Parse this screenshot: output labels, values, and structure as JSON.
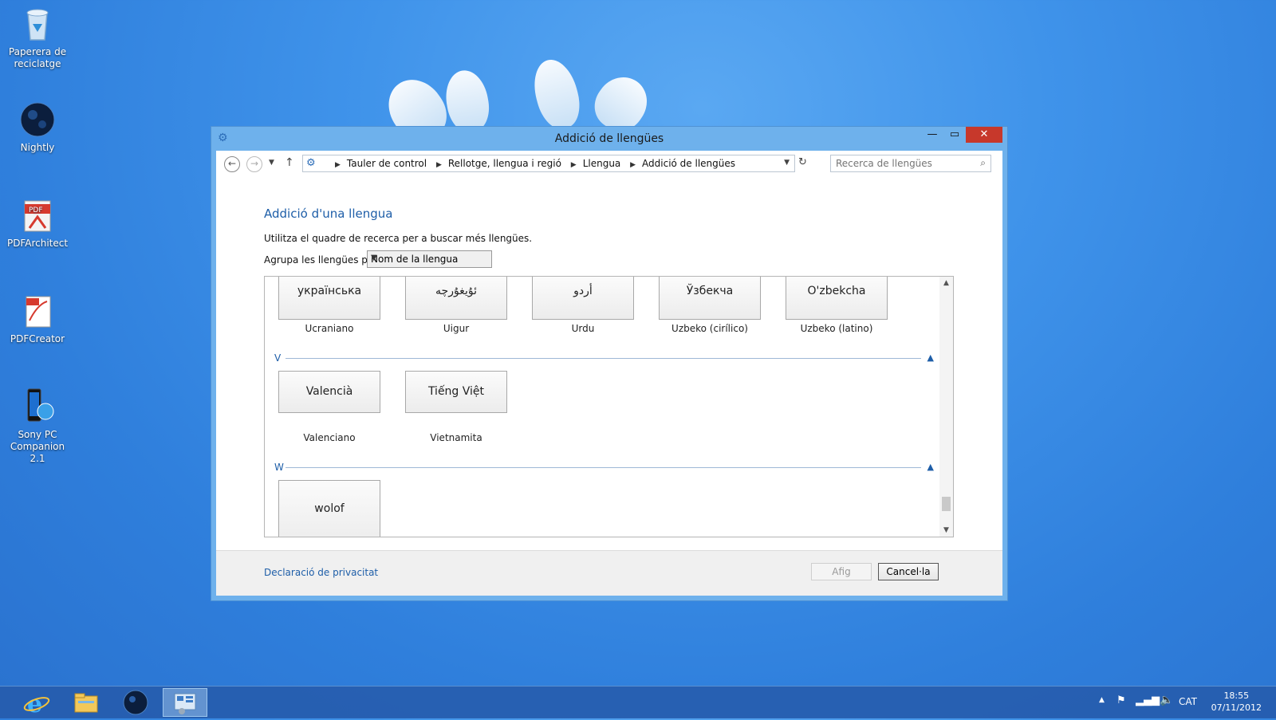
{
  "desktop": {
    "icons": [
      {
        "label": "Paperera de reciclatge",
        "icon": "recycle-bin-icon"
      },
      {
        "label": "Nightly",
        "icon": "nightly-globe-icon"
      },
      {
        "label": "PDFArchitect",
        "icon": "pdfarchitect-icon"
      },
      {
        "label": "PDFCreator",
        "icon": "pdfcreator-icon"
      },
      {
        "label": "Sony PC Companion 2.1",
        "icon": "sony-pc-companion-icon"
      }
    ]
  },
  "window": {
    "title": "Addició de llengües",
    "controls": {
      "minimize": "—",
      "maximize": "▭",
      "close": "✕"
    },
    "breadcrumbs": [
      "Tauler de control",
      "Rellotge, llengua i regió",
      "Llengua",
      "Addició de llengües"
    ],
    "search_placeholder": "Recerca de llengües",
    "heading": "Addició d'una llengua",
    "description": "Utilitza el quadre de recerca per a buscar més llengües.",
    "group_label": "Agrupa les llengües per:",
    "group_value": "Nom de la llengua",
    "list": {
      "top_row": [
        {
          "native": "українська",
          "name": "Ucraniano"
        },
        {
          "native": "ئۇيغۇرچە",
          "name": "Uigur"
        },
        {
          "native": "أردو",
          "name": "Urdu"
        },
        {
          "native": "Ўзбекча",
          "name": "Uzbeko (cirílico)"
        },
        {
          "native": "O'zbekcha",
          "name": "Uzbeko (latino)"
        }
      ],
      "sections": [
        {
          "letter": "V",
          "items": [
            {
              "native": "Valencià",
              "name": "Valenciano"
            },
            {
              "native": "Tiếng Việt",
              "name": "Vietnamita"
            }
          ]
        },
        {
          "letter": "W",
          "items": [
            {
              "native": "wolof",
              "name": ""
            }
          ]
        }
      ]
    },
    "footer": {
      "privacy": "Declaració de privacitat",
      "add": "Afig",
      "cancel": "Cancel·la"
    }
  },
  "taskbar": {
    "apps": [
      "internet-explorer-icon",
      "file-explorer-icon",
      "nightly-globe-icon",
      "control-panel-icon"
    ],
    "language": "CAT",
    "time": "18:55",
    "date": "07/11/2012"
  }
}
